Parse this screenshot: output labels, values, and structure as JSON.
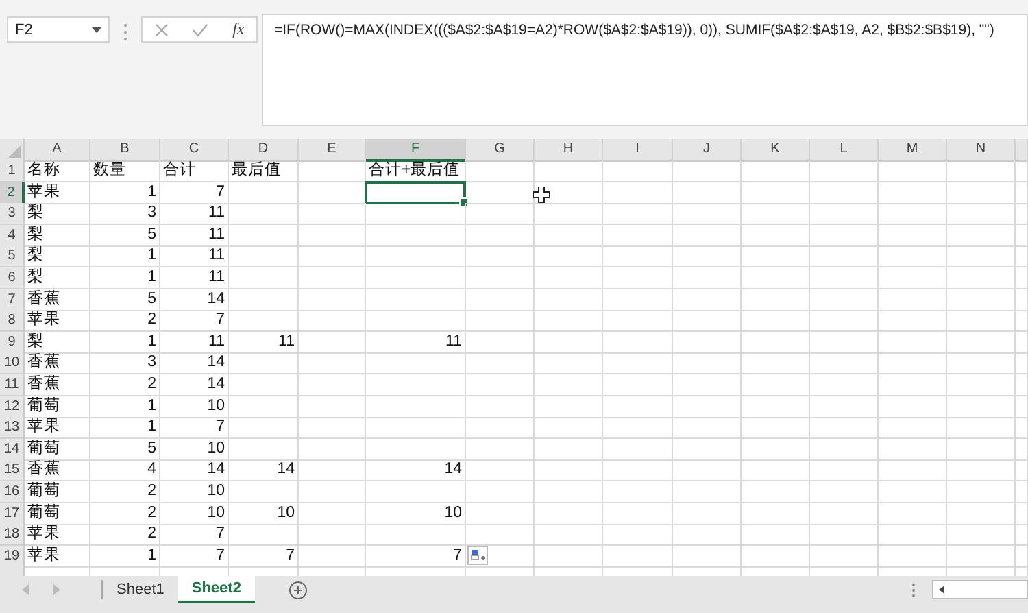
{
  "name_box": "F2",
  "fx_label": "fx",
  "formula": "=IF(ROW()=MAX(INDEX((($A$2:$A$19=A2)*ROW($A$2:$A$19)), 0)), SUMIF($A$2:$A$19, A2, $B$2:$B$19), \"\")",
  "columns": [
    {
      "label": "A",
      "selected": false
    },
    {
      "label": "B",
      "selected": false
    },
    {
      "label": "C",
      "selected": false
    },
    {
      "label": "D",
      "selected": false
    },
    {
      "label": "E",
      "selected": false
    },
    {
      "label": "F",
      "selected": true
    },
    {
      "label": "G",
      "selected": false
    },
    {
      "label": "H",
      "selected": false
    },
    {
      "label": "I",
      "selected": false
    },
    {
      "label": "J",
      "selected": false
    },
    {
      "label": "K",
      "selected": false
    },
    {
      "label": "L",
      "selected": false
    },
    {
      "label": "M",
      "selected": false
    },
    {
      "label": "N",
      "selected": false
    }
  ],
  "rows": [
    {
      "number": "1",
      "selected": false,
      "cells": [
        "名称",
        "数量",
        "合计",
        "最后值",
        "",
        "合计+最后值"
      ]
    },
    {
      "number": "2",
      "selected": true,
      "cells": [
        "苹果",
        "1",
        "7",
        "",
        "",
        ""
      ]
    },
    {
      "number": "3",
      "selected": false,
      "cells": [
        "梨",
        "3",
        "11",
        "",
        "",
        ""
      ]
    },
    {
      "number": "4",
      "selected": false,
      "cells": [
        "梨",
        "5",
        "11",
        "",
        "",
        ""
      ]
    },
    {
      "number": "5",
      "selected": false,
      "cells": [
        "梨",
        "1",
        "11",
        "",
        "",
        ""
      ]
    },
    {
      "number": "6",
      "selected": false,
      "cells": [
        "梨",
        "1",
        "11",
        "",
        "",
        ""
      ]
    },
    {
      "number": "7",
      "selected": false,
      "cells": [
        "香蕉",
        "5",
        "14",
        "",
        "",
        ""
      ]
    },
    {
      "number": "8",
      "selected": false,
      "cells": [
        "苹果",
        "2",
        "7",
        "",
        "",
        ""
      ]
    },
    {
      "number": "9",
      "selected": false,
      "cells": [
        "梨",
        "1",
        "11",
        "11",
        "",
        "11"
      ]
    },
    {
      "number": "10",
      "selected": false,
      "cells": [
        "香蕉",
        "3",
        "14",
        "",
        "",
        ""
      ]
    },
    {
      "number": "11",
      "selected": false,
      "cells": [
        "香蕉",
        "2",
        "14",
        "",
        "",
        ""
      ]
    },
    {
      "number": "12",
      "selected": false,
      "cells": [
        "葡萄",
        "1",
        "10",
        "",
        "",
        ""
      ]
    },
    {
      "number": "13",
      "selected": false,
      "cells": [
        "苹果",
        "1",
        "7",
        "",
        "",
        ""
      ]
    },
    {
      "number": "14",
      "selected": false,
      "cells": [
        "葡萄",
        "5",
        "10",
        "",
        "",
        ""
      ]
    },
    {
      "number": "15",
      "selected": false,
      "cells": [
        "香蕉",
        "4",
        "14",
        "14",
        "",
        "14"
      ]
    },
    {
      "number": "16",
      "selected": false,
      "cells": [
        "葡萄",
        "2",
        "10",
        "",
        "",
        ""
      ]
    },
    {
      "number": "17",
      "selected": false,
      "cells": [
        "葡萄",
        "2",
        "10",
        "10",
        "",
        "10"
      ]
    },
    {
      "number": "18",
      "selected": false,
      "cells": [
        "苹果",
        "2",
        "7",
        "",
        "",
        ""
      ]
    },
    {
      "number": "19",
      "selected": false,
      "cells": [
        "苹果",
        "1",
        "7",
        "7",
        "",
        "7"
      ]
    }
  ],
  "sheets": [
    {
      "label": "Sheet1",
      "selected": false
    },
    {
      "label": "Sheet2",
      "selected": true
    }
  ]
}
